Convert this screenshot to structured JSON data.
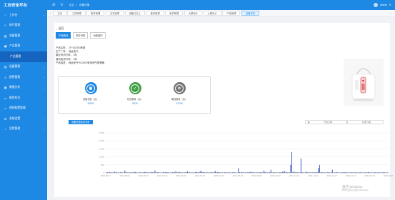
{
  "topbar": {
    "brand": "工业安全平台",
    "crumbs": [
      "企业",
      "/",
      "设备详情"
    ],
    "user": "Admin"
  },
  "sidebar": {
    "items": [
      {
        "label": "工作台",
        "icon": "home-icon"
      },
      {
        "label": "账号管理",
        "icon": "user-icon"
      },
      {
        "label": "宅屋管理",
        "icon": "building-icon"
      },
      {
        "label": "产品管理",
        "icon": "box-icon"
      },
      {
        "label": "产品管理",
        "icon": "",
        "sub": true
      },
      {
        "label": "设备管理",
        "icon": "device-icon"
      },
      {
        "label": "报警管理",
        "icon": "alarm-icon"
      },
      {
        "label": "数据分析",
        "icon": "chart-icon"
      },
      {
        "label": "推荐知识",
        "icon": "book-icon"
      },
      {
        "label": "规则配置管理",
        "icon": "rule-icon"
      },
      {
        "label": "系统设置",
        "icon": "gear-icon"
      },
      {
        "label": "告警管理",
        "icon": "bell-icon"
      }
    ]
  },
  "tabs": [
    "主页",
    "工作管理",
    "账号管理",
    "日志管理",
    "设备日志上",
    "维修管理",
    "维护管理",
    "大屏设计",
    "大屏设计",
    "产品管理",
    "设备详情"
  ],
  "panel": {
    "back": "← 返回",
    "tabs": [
      "产品概况",
      "事件列表",
      "功能维护"
    ],
    "info": [
      "产品名称：  JT+ID2000家报",
      "生产厂商：  地运电气",
      "最近测试时间：  3年",
      "通讯测试时间：  3年",
      "产品描述：  地运电气+ID2000家用燃气报警器"
    ],
    "stats": [
      {
        "label": "设备总数（台）",
        "value": "19992",
        "color": "#1e88e5",
        "icon": "device-total-icon"
      },
      {
        "label": "在线数量（台）",
        "value": "6976",
        "color": "#43a047",
        "icon": "online-icon"
      },
      {
        "label": "离线数量（台）",
        "value": "13796",
        "color": "#757575",
        "icon": "offline-icon"
      }
    ],
    "chart_button": "设备在线情况分析",
    "date_range": {
      "start": "开始日期",
      "sep": "至",
      "end": "结束日期"
    }
  },
  "chart_data": {
    "type": "bar",
    "ylim": [
      0,
      2500
    ],
    "yticks": [
      "2,500",
      "2,000",
      "1,500",
      "1,000",
      "500",
      "0"
    ],
    "xticks": [
      "2020-09-17",
      "2021-05-02",
      "2021-05-21",
      "2021-06-13",
      "2021-06-23",
      "2021-07-03",
      "2021-07-13",
      "2021-08-23",
      "2021-09-03",
      "2021-09-18",
      "2021-11-13",
      "2021-12-03",
      "2021-12-27",
      "2022-01-17",
      "2022-03-03",
      "2022-04-08"
    ],
    "values": [
      30,
      40,
      20,
      60,
      25,
      35,
      20,
      90,
      30,
      40,
      25,
      20,
      35,
      60,
      20,
      30,
      150,
      40,
      30,
      25,
      30,
      40,
      20,
      35,
      60,
      50,
      30,
      20,
      25,
      40,
      30,
      20,
      35,
      45,
      60,
      30,
      40,
      25,
      30,
      50,
      35,
      40,
      150,
      30,
      40,
      35,
      25,
      30,
      20,
      60,
      30,
      50,
      40,
      35,
      30,
      25,
      20,
      45,
      30,
      40,
      110,
      30,
      40,
      50,
      35,
      25,
      30,
      20,
      40,
      35,
      100,
      30,
      40,
      25,
      30,
      35,
      20,
      45,
      60,
      30,
      40,
      90,
      120,
      30,
      50,
      35,
      25,
      40,
      30,
      20,
      40,
      35,
      30,
      60,
      110,
      30,
      45,
      40,
      35,
      25,
      30,
      20,
      40,
      35,
      30,
      25,
      40,
      30,
      20,
      35,
      40,
      30,
      25,
      20,
      300,
      40,
      30,
      50,
      35,
      25,
      30,
      20,
      40,
      35,
      60,
      70,
      30,
      40,
      25,
      30,
      35,
      20,
      45,
      30,
      40,
      30,
      150,
      50,
      35,
      25,
      30,
      40,
      200,
      30,
      40,
      35,
      25,
      30,
      20,
      40,
      35,
      30,
      60,
      90,
      100,
      30,
      40,
      25,
      30,
      500,
      1300,
      40,
      90,
      30,
      40,
      35,
      25,
      30,
      900,
      40,
      30,
      20,
      50,
      60,
      30,
      40,
      25,
      30,
      35,
      20,
      45,
      30,
      40,
      300,
      500,
      30,
      50,
      35,
      25,
      30,
      20,
      40,
      35,
      30,
      25,
      200,
      30,
      20,
      35,
      40,
      30,
      25,
      20,
      30,
      40,
      30,
      50,
      35,
      25,
      30,
      20,
      40,
      35,
      30,
      25,
      40,
      30,
      20,
      35,
      40,
      30,
      25,
      20,
      30,
      40,
      30,
      50,
      35,
      25,
      30,
      20,
      40,
      35,
      30,
      25,
      40,
      30,
      20,
      35,
      40,
      30,
      25,
      20,
      30
    ]
  },
  "watermark": {
    "line1": "激活 Windows",
    "line2": "转到\"设置\"以激活 Windows。"
  }
}
